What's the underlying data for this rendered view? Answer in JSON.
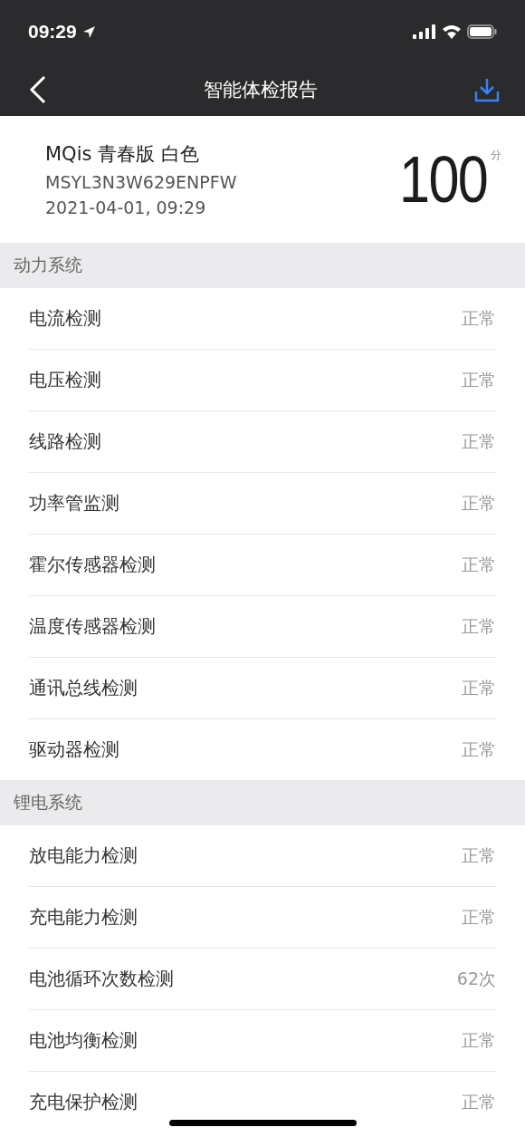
{
  "status_bar": {
    "time": "09:29"
  },
  "nav": {
    "title": "智能体检报告"
  },
  "device": {
    "name": "MQis 青春版 白色",
    "serial": "MSYL3N3W629ENPFW",
    "date": "2021-04-01, 09:29",
    "score": "100",
    "score_unit": "分"
  },
  "sections": [
    {
      "title": "动力系统",
      "rows": [
        {
          "label": "电流检测",
          "value": "正常"
        },
        {
          "label": "电压检测",
          "value": "正常"
        },
        {
          "label": "线路检测",
          "value": "正常"
        },
        {
          "label": "功率管监测",
          "value": "正常"
        },
        {
          "label": "霍尔传感器检测",
          "value": "正常"
        },
        {
          "label": "温度传感器检测",
          "value": "正常"
        },
        {
          "label": "通讯总线检测",
          "value": "正常"
        },
        {
          "label": "驱动器检测",
          "value": "正常"
        }
      ]
    },
    {
      "title": "锂电系统",
      "rows": [
        {
          "label": "放电能力检测",
          "value": "正常"
        },
        {
          "label": "充电能力检测",
          "value": "正常"
        },
        {
          "label": "电池循环次数检测",
          "value": "62次"
        },
        {
          "label": "电池均衡检测",
          "value": "正常"
        },
        {
          "label": "充电保护检测",
          "value": "正常"
        }
      ]
    }
  ]
}
